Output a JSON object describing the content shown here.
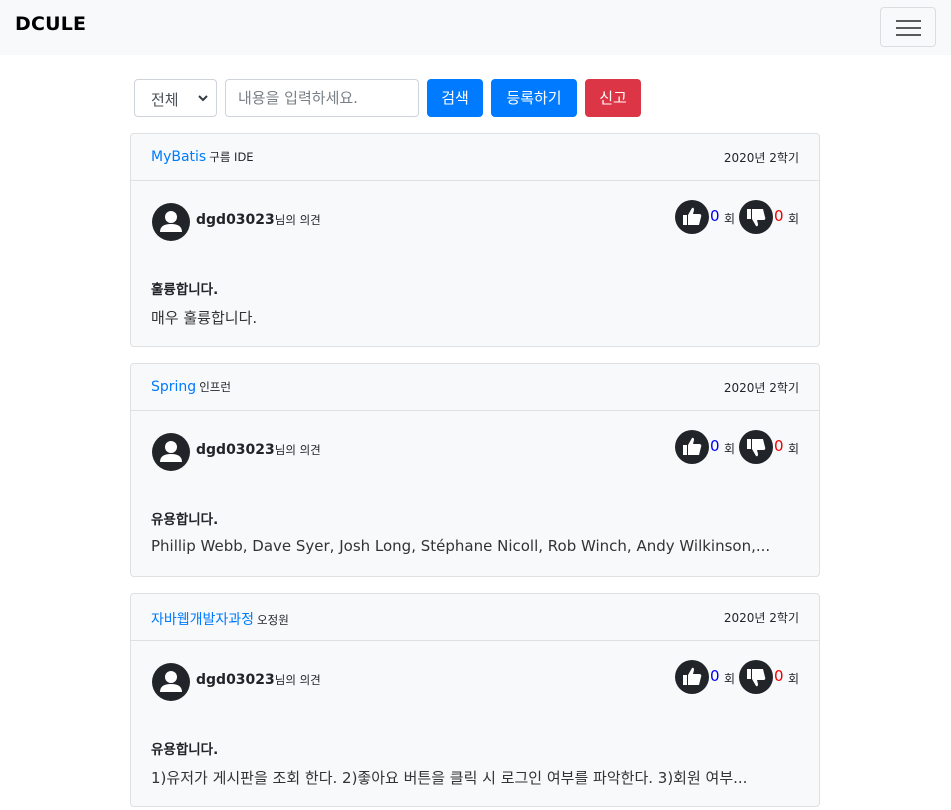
{
  "navbar": {
    "brand": "DCULE"
  },
  "toolbar": {
    "filter_selected": "전체",
    "search_placeholder": "내용을 입력하세요.",
    "search_label": "검색",
    "register_label": "등록하기",
    "report_label": "신고"
  },
  "reviews": [
    {
      "course": "MyBatis",
      "professor": "구름 IDE",
      "semester": "2020년 2학기",
      "author": "dgd03023",
      "author_suffix": "님의 의견",
      "likes": "0",
      "dislikes": "0",
      "count_unit": "회",
      "title": "훌륭합니다.",
      "body": "매우 훌륭합니다."
    },
    {
      "course": "Spring",
      "professor": "인프런",
      "semester": "2020년 2학기",
      "author": "dgd03023",
      "author_suffix": "님의 의견",
      "likes": "0",
      "dislikes": "0",
      "count_unit": "회",
      "title": "유용합니다.",
      "body": "Phillip Webb, Dave Syer, Josh Long, Stéphane Nicoll, Rob Winch, Andy Wilkinson,..."
    },
    {
      "course": "자바웹개발자과정",
      "professor": "오정원",
      "semester": "2020년 2학기",
      "author": "dgd03023",
      "author_suffix": "님의 의견",
      "likes": "0",
      "dislikes": "0",
      "count_unit": "회",
      "title": "유용합니다.",
      "body": "1)유저가 게시판을 조회 한다. 2)좋아요 버튼을 클릭 시 로그인 여부를 파악한다. 3)회원 여부..."
    }
  ],
  "colors": {
    "primary": "#007bff",
    "danger": "#dc3545",
    "like_count": "#0000ee",
    "dislike_count": "#ee0000",
    "icon_dark": "#212529"
  },
  "icons": [
    "hamburger-icon",
    "chevron-down-icon",
    "user-avatar-icon",
    "thumbs-up-icon",
    "thumbs-down-icon"
  ]
}
